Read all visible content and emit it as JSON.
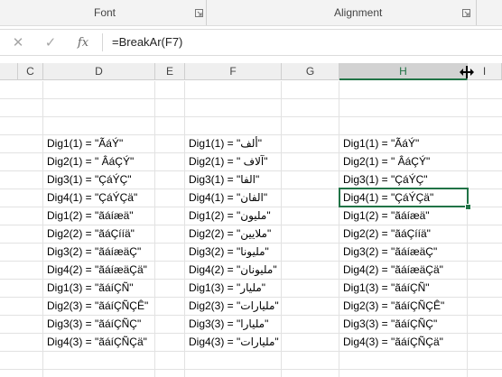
{
  "ribbon": {
    "font_label": "Font",
    "alignment_label": "Alignment"
  },
  "formula_bar": {
    "cancel_icon": "✕",
    "enter_icon": "✓",
    "fx_label": "fx",
    "formula": "=BreakAr(F7)"
  },
  "columns": {
    "c": "C",
    "d": "D",
    "e": "E",
    "f": "F",
    "g": "G",
    "h": "H",
    "i": "I"
  },
  "col_d": [
    "Dig1(1) = \"ÃáÝ\"",
    "Dig2(1) = \" ÂáÇÝ\"",
    "Dig3(1) = \"ÇáÝÇ\"",
    "Dig4(1) = \"ÇáÝÇä\"",
    "Dig1(2) = \"ãáíæä\"",
    "Dig2(2) = \"ãáÇííä\"",
    "Dig3(2) = \"ãáíæäÇ\"",
    "Dig4(2) = \"ãáíæäÇä\"",
    "Dig1(3) = \"ãáíÇÑ\"",
    "Dig2(3) = \"ãáíÇÑÇÊ\"",
    "Dig3(3) = \"ãáíÇÑÇ\"",
    "Dig4(3) = \"ãáíÇÑÇä\""
  ],
  "col_f": [
    "Dig1(1) = \"ألف\"",
    "Dig2(1) = \" آلاف\"",
    "Dig3(1) = \"الفا\"",
    "Dig4(1) = \"الفان\"",
    "Dig1(2) = \"مليون\"",
    "Dig2(2) = \"ملايين\"",
    "Dig3(2) = \"مليونا\"",
    "Dig4(2) = \"مليونان\"",
    "Dig1(3) = \"مليار\"",
    "Dig2(3) = \"مليارات\"",
    "Dig3(3) = \"مليارا\"",
    "Dig4(3) = \"مليارات\""
  ],
  "col_h": [
    "Dig1(1) = \"ÃáÝ\"",
    "Dig2(1) = \" ÂáÇÝ\"",
    "Dig3(1) = \"ÇáÝÇ\"",
    "Dig4(1) = \"ÇáÝÇä\"",
    "Dig1(2) = \"ãáíæä\"",
    "Dig2(2) = \"ãáÇííä\"",
    "Dig3(2) = \"ãáíæäÇ\"",
    "Dig4(2) = \"ãáíæäÇä\"",
    "Dig1(3) = \"ãáíÇÑ\"",
    "Dig2(3) = \"ãáíÇÑÇÊ\"",
    "Dig3(3) = \"ãáíÇÑÇ\"",
    "Dig4(3) = \"ãáíÇÑÇä\""
  ],
  "colors": {
    "accent": "#217346",
    "header_bg": "#efefef",
    "gridline": "#e2e2e2"
  }
}
